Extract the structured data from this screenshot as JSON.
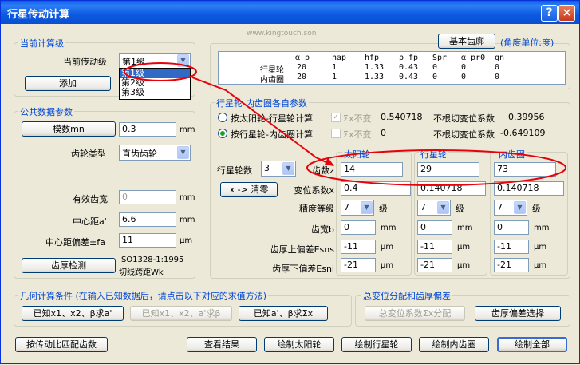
{
  "window": {
    "title": "行星传动计算",
    "help_icon": "?",
    "close_icon": "×"
  },
  "watermark": "www.kingtouch.son",
  "current": {
    "group_label": "当前计算级",
    "stage_label": "当前传动级",
    "stage_value": "第1级",
    "stage_options": [
      "第1级",
      "第2级",
      "第3级"
    ],
    "add_button": "添加"
  },
  "top_right": {
    "basic_profile_button": "基本齿廓",
    "angle_unit": "(角度单位:度)",
    "table_headers": [
      "α p",
      "hap",
      "hfp",
      "ρ fp",
      "Spr",
      "α pr0",
      "qn"
    ],
    "rows": [
      {
        "name": "行星轮",
        "values": [
          "20",
          "1",
          "1.33",
          "0.43",
          "0",
          "0",
          "0"
        ]
      },
      {
        "name": "内齿圈",
        "values": [
          "20",
          "1",
          "1.33",
          "0.43",
          "0",
          "0",
          "0"
        ]
      }
    ]
  },
  "common": {
    "group_label": "公共数据参数",
    "module_button": "模数mn",
    "module_value": "0.3",
    "module_unit": "mm",
    "gear_type_label": "齿轮类型",
    "gear_type_value": "直齿齿轮",
    "effective_width_label": "有效齿宽",
    "effective_width_value": "0",
    "effective_width_unit": "mm",
    "center_distance_label": "中心距a'",
    "center_distance_value": "6.6",
    "center_distance_unit": "mm",
    "center_tol_label": "中心距偏差±fa",
    "center_tol_value": "11",
    "center_tol_unit": "μm",
    "thickness_check_button": "齿厚检测",
    "thickness_check_text_1": "ISO1328-1:1995",
    "thickness_check_text_2": "切线跨距Wk"
  },
  "planet": {
    "group_label": "行星轮-内齿圈各自参数",
    "radio1_label": "按太阳轮-行星轮计算",
    "radio1_chk": "Σx不变",
    "radio1_val": "0.540718",
    "radio1_note": "不根切变位系数",
    "radio1_note_val": "0.39956",
    "radio2_label": "按行星轮-内齿圈计算",
    "radio2_chk": "Σx不变",
    "radio2_val": "0",
    "radio2_note": "不根切变位系数",
    "radio2_note_val": "-0.649109",
    "planet_count_label": "行星轮数",
    "planet_count_value": "3",
    "clear_button": "x -> 清零",
    "col_headers": [
      "太阳轮",
      "行星轮",
      "内齿圈"
    ],
    "teeth_label": "齿数z",
    "teeth": [
      "14",
      "29",
      "73"
    ],
    "shift_label": "变位系数x",
    "shift": [
      "0.4",
      "0.140718",
      "0.140718"
    ],
    "grade_label": "精度等级",
    "grade": [
      "7",
      "7",
      "7"
    ],
    "grade_unit": "级",
    "width_label": "齿宽b",
    "width": [
      "0",
      "0",
      "0"
    ],
    "width_unit": "mm",
    "esns_label": "齿厚上偏差Esns",
    "esns": [
      "-11",
      "-11",
      "-11"
    ],
    "esni_label": "齿厚下偏差Esni",
    "esni": [
      "-21",
      "-21",
      "-21"
    ],
    "um_unit": "μm"
  },
  "geometry": {
    "group_label": "几何计算条件 (在输入已知数据后，请点击以下对应的求值方法)",
    "btn1": "已知x1、x2、β求a'",
    "btn2": "已知x1、x2、a'求β",
    "btn3": "已知a'、β求Σx"
  },
  "shift_dist": {
    "group_label": "总变位分配和齿厚偏差",
    "btn1": "总变位系数Σx分配",
    "btn2": "齿厚偏差选择"
  },
  "bottom": {
    "btn_match": "按传动比匹配齿数",
    "btn_results": "查看结果",
    "btn_sun": "绘制太阳轮",
    "btn_planet": "绘制行星轮",
    "btn_ring": "绘制内齿圈",
    "btn_all": "绘制全部"
  },
  "colors": {
    "title_bar": "#0a5ee6",
    "group_label": "#0046d5",
    "annotation": "#e8000b",
    "selection": "#316ac5"
  }
}
